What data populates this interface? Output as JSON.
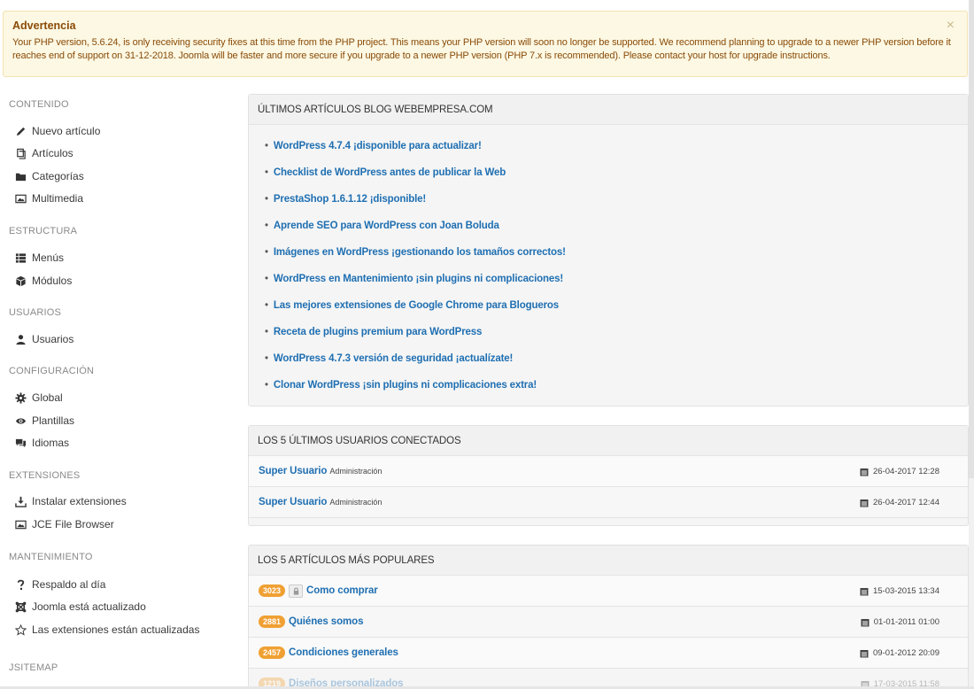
{
  "alert": {
    "title": "Advertencia",
    "text": "Your PHP version, 5.6.24, is only receiving security fixes at this time from the PHP project. This means your PHP version will soon no longer be supported. We recommend planning to upgrade to a newer PHP version before it reaches end of support on 31-12-2018. Joomla will be faster and more secure if you upgrade to a newer PHP version (PHP 7.x is recommended). Please contact your host for upgrade instructions.",
    "close": "×"
  },
  "sidebar": {
    "contenido": {
      "title": "CONTENIDO",
      "items": [
        {
          "label": "Nuevo artículo",
          "icon": "pencil-icon"
        },
        {
          "label": "Artículos",
          "icon": "copy-icon"
        },
        {
          "label": "Categorías",
          "icon": "folder-icon"
        },
        {
          "label": "Multimedia",
          "icon": "image-icon"
        }
      ]
    },
    "estructura": {
      "title": "ESTRUCTURA",
      "items": [
        {
          "label": "Menús",
          "icon": "list-icon"
        },
        {
          "label": "Módulos",
          "icon": "cube-icon"
        }
      ]
    },
    "usuarios": {
      "title": "USUARIOS",
      "items": [
        {
          "label": "Usuarios",
          "icon": "user-icon"
        }
      ]
    },
    "configuracion": {
      "title": "CONFIGURACIÓN",
      "items": [
        {
          "label": "Global",
          "icon": "cog-icon"
        },
        {
          "label": "Plantillas",
          "icon": "eye-icon"
        },
        {
          "label": "Idiomas",
          "icon": "comments-icon"
        }
      ]
    },
    "extensiones": {
      "title": "EXTENSIONES",
      "items": [
        {
          "label": "Instalar extensiones",
          "icon": "download-icon"
        },
        {
          "label": "JCE File Browser",
          "icon": "image-icon"
        }
      ]
    },
    "mantenimiento": {
      "title": "MANTENIMIENTO",
      "items": [
        {
          "label": "Respaldo al día",
          "icon": "question-icon"
        },
        {
          "label": "Joomla está actualizado",
          "icon": "joomla-icon"
        },
        {
          "label": "Las extensiones están actualizadas",
          "icon": "star-icon"
        }
      ]
    },
    "jsitemap": {
      "title": "JSITEMAP"
    }
  },
  "blog": {
    "title": "ÚLTIMOS ARTÍCULOS BLOG WEBEMPRESA.COM",
    "items": [
      "WordPress 4.7.4 ¡disponible para actualizar!",
      "Checklist de WordPress antes de publicar la Web",
      "PrestaShop 1.6.1.12 ¡disponible!",
      "Aprende SEO para WordPress con Joan Boluda",
      "Imágenes en WordPress ¡gestionando los tamaños correctos!",
      "WordPress en Mantenimiento ¡sin plugins ni complicaciones!",
      "Las mejores extensiones de Google Chrome para Blogueros",
      "Receta de plugins premium para WordPress",
      "WordPress 4.7.3 versión de seguridad ¡actualízate!",
      "Clonar WordPress ¡sin plugins ni complicaciones extra!"
    ]
  },
  "users": {
    "title": "LOS 5 ÚLTIMOS USUARIOS CONECTADOS",
    "rows": [
      {
        "name": "Super Usuario",
        "role": "Administración",
        "date": "26-04-2017 12:28"
      },
      {
        "name": "Super Usuario",
        "role": "Administración",
        "date": "26-04-2017 12:44"
      }
    ]
  },
  "popular": {
    "title": "LOS 5 ARTÍCULOS MÁS POPULARES",
    "rows": [
      {
        "hits": "3023",
        "title": "Como comprar",
        "date": "15-03-2015 13:34",
        "locked": true
      },
      {
        "hits": "2881",
        "title": "Quiénes somos",
        "date": "01-01-2011 01:00",
        "locked": false
      },
      {
        "hits": "2457",
        "title": "Condiciones generales",
        "date": "09-01-2012 20:09",
        "locked": false
      },
      {
        "hits": "1219",
        "title": "Diseños personalizados",
        "date": "17-03-2015 11:58",
        "locked": false
      }
    ]
  }
}
